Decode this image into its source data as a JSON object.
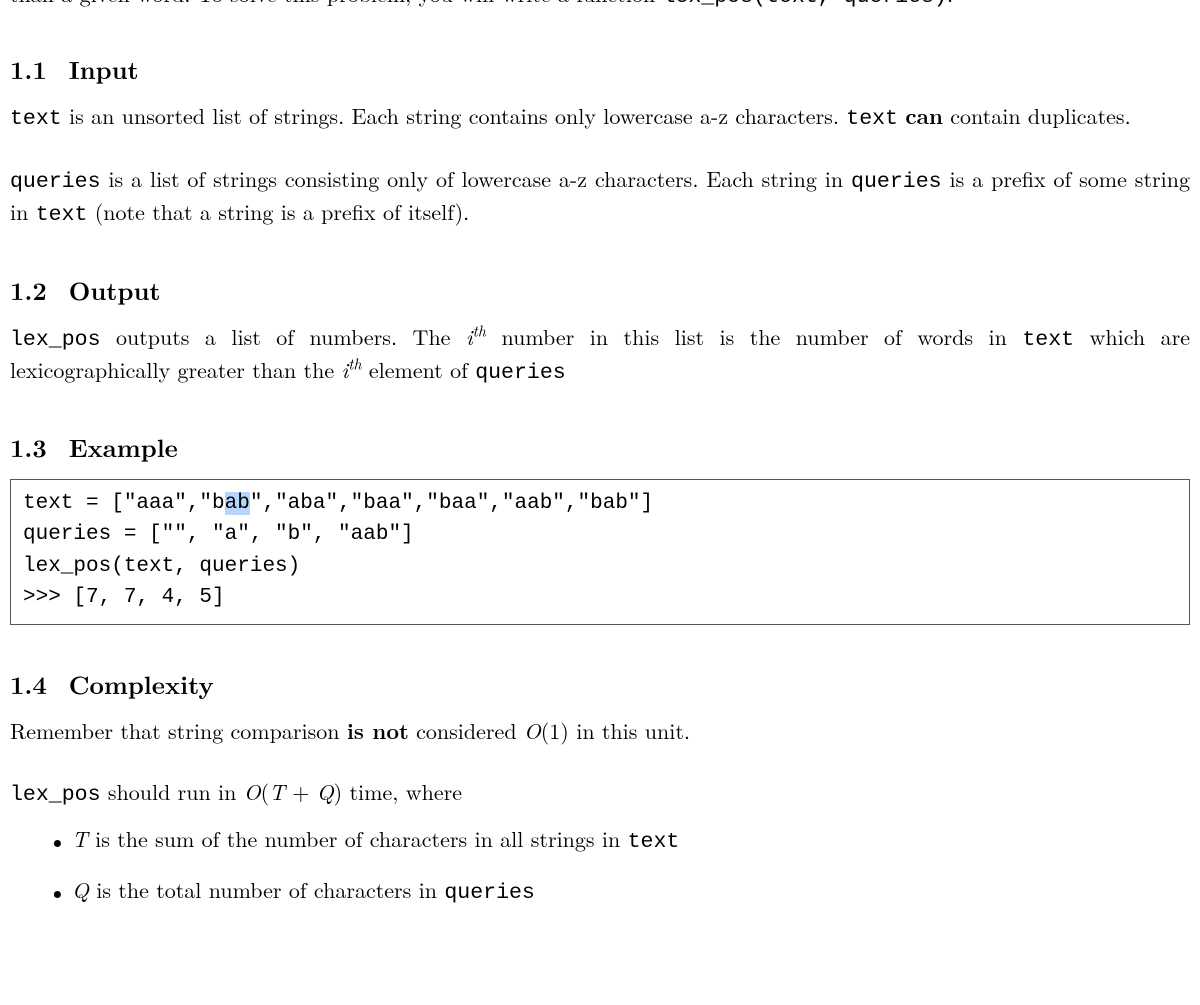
{
  "partial_top": {
    "pre": "than a given word.  To solve this problem, you will write a function ",
    "code": "lex_pos(text, queries)",
    "post": "."
  },
  "s11": {
    "num": "1.1",
    "title": "Input",
    "p1": {
      "code1": "text",
      "t1": " is an unsorted list of strings.  Each string contains only lowercase a-z characters.  ",
      "code2": "text",
      "t2": " ",
      "bold1": "can",
      "t3": " contain duplicates."
    },
    "p2": {
      "code1": "queries",
      "t1": " is a list of strings consisting only of lowercase a-z characters.  Each string in ",
      "code2": "queries",
      "t2": " is a prefix of some string in ",
      "code3": "text",
      "t3": " (note that a string is a prefix of itself)."
    }
  },
  "s12": {
    "num": "1.2",
    "title": "Output",
    "p1": {
      "code1": "lex_pos",
      "t1": " outputs a list of numbers. The ",
      "ith_i1": "i",
      "ith_th1": "th",
      "t2": " number in this list is the number of words in ",
      "code2": "text",
      "t3": " which are lexicographically greater than the ",
      "ith_i2": "i",
      "ith_th2": "th",
      "t4": " element of ",
      "code3": "queries"
    }
  },
  "s13": {
    "num": "1.3",
    "title": "Example",
    "code": {
      "l1a": "text = [\"aaa\",\"b",
      "l1hl": "ab",
      "l1b": "\",\"aba\",\"baa\",\"baa\",\"aab\",\"bab\"]",
      "l2": "queries = [\"\", \"a\", \"b\", \"aab\"]",
      "l3": "lex_pos(text, queries)",
      "l4": ">>> [7, 7, 4, 5]"
    }
  },
  "s14": {
    "num": "1.4",
    "title": "Complexity",
    "p1": {
      "t1": "Remember that string comparison ",
      "bold1": "is not",
      "t2": " considered ",
      "bigO": "O",
      "arg": "(1)",
      "t3": " in this unit."
    },
    "p2": {
      "code1": "lex_pos",
      "t1": " should run in ",
      "bigO": "O",
      "paren_open": "(",
      "T": "T",
      "plus": " + ",
      "Q": "Q",
      "paren_close": ")",
      "t2": " time, where"
    },
    "b1": {
      "T": "T",
      "t1": " is the sum of the number of characters in all strings in ",
      "code1": "text"
    },
    "b2": {
      "Q": "Q",
      "t1": " is the total number of characters in ",
      "code1": "queries"
    }
  }
}
